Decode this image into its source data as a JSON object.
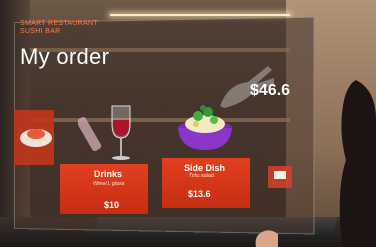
{
  "menu": {
    "subtitle_line1": "SMART RESTAURANT",
    "subtitle_line2": "SUSHI BAR",
    "title": "My order",
    "total": "$46.6"
  },
  "items": [
    {
      "name": "Drinks",
      "desc": "Wine/1 glass",
      "price": "$10"
    },
    {
      "name": "Side Dish",
      "desc": "Tofu salad",
      "price": "$13.6"
    }
  ],
  "colors": {
    "accent": "#e2401f",
    "subtitle": "#ff7a4a",
    "text": "#ffffff"
  }
}
